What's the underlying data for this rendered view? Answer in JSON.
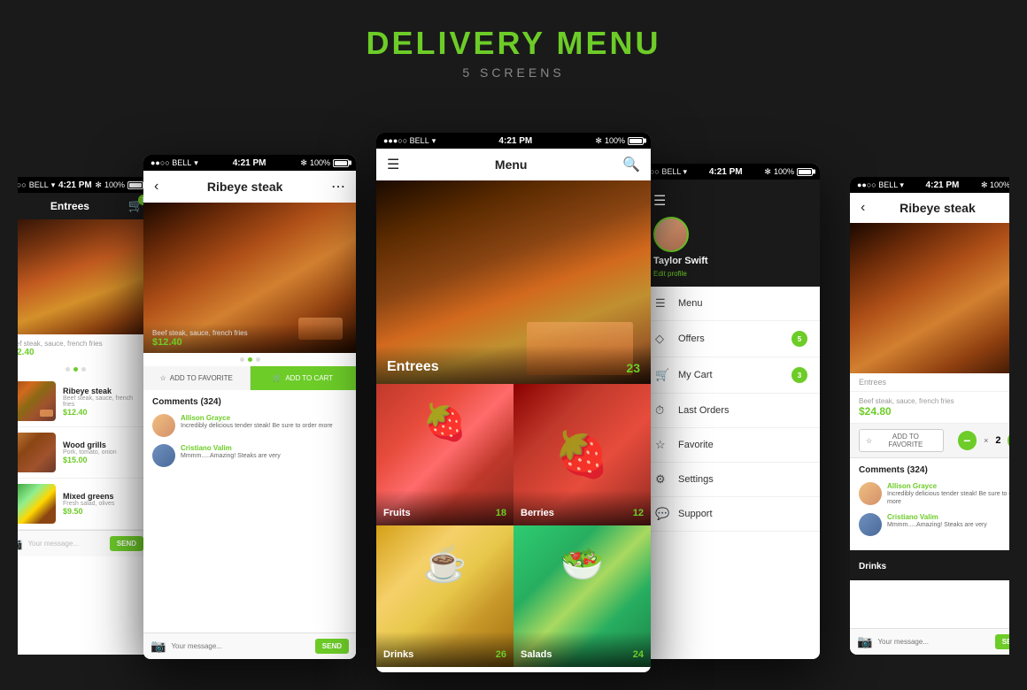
{
  "page": {
    "title": "DELIVERY MENU",
    "subtitle": "5 SCREENS"
  },
  "status_bar": {
    "carrier": "BELL",
    "time": "4:21 PM",
    "battery": "100%"
  },
  "screen1": {
    "title": "Entrees",
    "items": [
      {
        "name": "Ribeye steak",
        "desc": "Beef steak, sauce, french fries",
        "price": "$12.40"
      },
      {
        "name": "Wood grills",
        "desc": "Pork, tomato, onion",
        "price": "$15.00"
      }
    ]
  },
  "screen2": {
    "title": "Ribeye steak",
    "desc": "Beef steak, sauce, french fries",
    "price": "$12.40",
    "btn_fav": "ADD TO FAVORITE",
    "btn_cart": "ADD TO CART",
    "comments_title": "Comments (324)",
    "comments": [
      {
        "name": "Allison Grayce",
        "text": "Incredibly delicious tender steak! Be sure to order more"
      },
      {
        "name": "Cristiano Valim",
        "text": "Mmmm.....Amazing! Steaks are very"
      }
    ],
    "message_placeholder": "Your message...",
    "send_label": "SEND"
  },
  "screen3": {
    "nav_title": "Menu",
    "hero_category": "Entrees",
    "hero_count": "23",
    "categories": [
      {
        "name": "Fruits",
        "count": "18"
      },
      {
        "name": "Drinks",
        "count": "26"
      },
      {
        "name": "Salads",
        "count": "24"
      }
    ]
  },
  "screen4": {
    "user_name": "Taylor Swift",
    "user_edit": "Edit profile",
    "menu_items": [
      {
        "icon": "☰",
        "label": "Menu",
        "badge": null
      },
      {
        "icon": "◇",
        "label": "Offers",
        "badge": "5"
      },
      {
        "icon": "🛒",
        "label": "My Cart",
        "badge": "3"
      },
      {
        "icon": "⏱",
        "label": "Last Orders",
        "badge": null
      },
      {
        "icon": "☆",
        "label": "Favorite",
        "badge": null
      },
      {
        "icon": "⚙",
        "label": "Settings",
        "badge": null
      },
      {
        "icon": "💬",
        "label": "Support",
        "badge": null
      }
    ]
  },
  "screen5": {
    "title": "Ribeye steak",
    "price": "$24.80",
    "qty": "2",
    "btn_fav": "ADD TO FAVORITE",
    "minus_label": "−",
    "plus_label": "+",
    "comments_title": "Comments (324)",
    "comments": [
      {
        "name": "Allison Grayce",
        "text": "Incredibly delicious tender steak! Be sure to order more"
      },
      {
        "name": "Cristiano Valim",
        "text": "Mmmm.....Amazing! Steaks are very"
      }
    ],
    "message_placeholder": "Your message...",
    "send_label": "SEND",
    "bottom_category": "Drinks"
  }
}
